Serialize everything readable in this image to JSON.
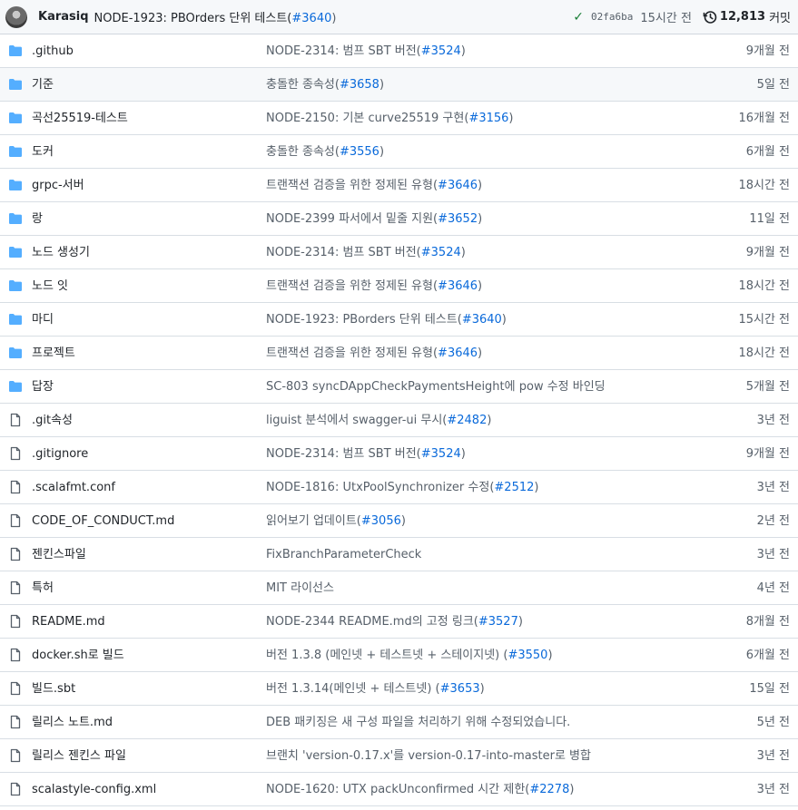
{
  "header": {
    "author": "Karasiq",
    "message": "NODE-1923: PBOrders 단위 테스트(",
    "pr": "#3640",
    "close": ")",
    "sha": "02fa6ba",
    "time": "15시간 전",
    "commits_count": "12,813",
    "commits_label": "커밋"
  },
  "rows": [
    {
      "type": "folder",
      "name": ".github",
      "msg": "NODE-2314: 범프 SBT 버전(",
      "pr": "#3524",
      "close": ")",
      "age": "9개월 전"
    },
    {
      "type": "folder",
      "name": "기준",
      "msg": "충돌한 종속성(",
      "pr": "#3658",
      "close": ")",
      "age": "5일 전"
    },
    {
      "type": "folder",
      "name": "곡선25519-테스트",
      "msg": "NODE-2150: 기본 curve25519 구현(",
      "pr": "#3156",
      "close": ")",
      "age": "16개월 전"
    },
    {
      "type": "folder",
      "name": "도커",
      "msg": "충돌한 종속성(",
      "pr": "#3556",
      "close": ")",
      "age": "6개월 전"
    },
    {
      "type": "folder",
      "name": "grpc-서버",
      "msg": "트랜잭션 검증을 위한 정제된 유형(",
      "pr": "#3646",
      "close": ")",
      "age": "18시간 전"
    },
    {
      "type": "folder",
      "name": "랑",
      "msg": "NODE-2399 파서에서 밑줄 지원(",
      "pr": "#3652",
      "close": ")",
      "age": "11일 전"
    },
    {
      "type": "folder",
      "name": "노드 생성기",
      "msg": "NODE-2314: 범프 SBT 버전(",
      "pr": "#3524",
      "close": ")",
      "age": "9개월 전"
    },
    {
      "type": "folder",
      "name": "노드 잇",
      "msg": "트랜잭션 검증을 위한 정제된 유형(",
      "pr": "#3646",
      "close": ")",
      "age": "18시간 전"
    },
    {
      "type": "folder",
      "name": "마디",
      "msg": "NODE-1923: PBorders 단위 테스트(",
      "pr": "#3640",
      "close": ")",
      "age": "15시간 전"
    },
    {
      "type": "folder",
      "name": "프로젝트",
      "msg": "트랜잭션 검증을 위한 정제된 유형(",
      "pr": "#3646",
      "close": ")",
      "age": "18시간 전"
    },
    {
      "type": "folder",
      "name": "답장",
      "msg": "SC-803 syncDAppCheckPaymentsHeight에 pow 수정 바인딩",
      "pr": "",
      "close": "",
      "age": "5개월 전"
    },
    {
      "type": "file",
      "name": ".git속성",
      "msg": "liguist 분석에서 swagger-ui 무시(",
      "pr": "#2482",
      "close": ")",
      "age": "3년 전"
    },
    {
      "type": "file",
      "name": ".gitignore",
      "msg": "NODE-2314: 범프 SBT 버전(",
      "pr": "#3524",
      "close": ")",
      "age": "9개월 전"
    },
    {
      "type": "file",
      "name": ".scalafmt.conf",
      "msg": "NODE-1816: UtxPoolSynchronizer 수정(",
      "pr": "#2512",
      "close": ")",
      "age": "3년 전"
    },
    {
      "type": "file",
      "name": "CODE_OF_CONDUCT.md",
      "msg": "읽어보기 업데이트(",
      "pr": "#3056",
      "close": ")",
      "age": "2년 전"
    },
    {
      "type": "file",
      "name": "젠킨스파일",
      "msg": "FixBranchParameterCheck",
      "pr": "",
      "close": "",
      "age": "3년 전"
    },
    {
      "type": "file",
      "name": "특허",
      "msg": "MIT 라이선스",
      "pr": "",
      "close": "",
      "age": "4년 전"
    },
    {
      "type": "file",
      "name": "README.md",
      "msg": "NODE-2344 README.md의 고정 링크(",
      "pr": "#3527",
      "close": ")",
      "age": "8개월 전"
    },
    {
      "type": "file",
      "name": "docker.sh로 빌드",
      "msg": "버전 1.3.8 (메인넷 + 테스트넷 + 스테이지넷) (",
      "pr": "#3550",
      "close": ")",
      "age": "6개월 전"
    },
    {
      "type": "file",
      "name": "빌드.sbt",
      "msg": "버전 1.3.14(메인넷 + 테스트넷) (",
      "pr": "#3653",
      "close": ")",
      "age": "15일 전"
    },
    {
      "type": "file",
      "name": "릴리스 노트.md",
      "msg": "DEB 패키징은 새 구성 파일을 처리하기 위해 수정되었습니다.",
      "pr": "",
      "close": "",
      "age": "5년 전"
    },
    {
      "type": "file",
      "name": "릴리스 젠킨스 파일",
      "msg": "브랜치 'version-0.17.x'를 version-0.17-into-master로 병합",
      "pr": "",
      "close": "",
      "age": "3년 전"
    },
    {
      "type": "file",
      "name": "scalastyle-config.xml",
      "msg": "NODE-1620: UTX packUnconfirmed 시간 제한(",
      "pr": "#2278",
      "close": ")",
      "age": "3년 전"
    }
  ],
  "colors": {
    "folder": "#54aeff",
    "link": "#0969da",
    "check": "#1a7f37"
  },
  "highlighted_row": 1
}
